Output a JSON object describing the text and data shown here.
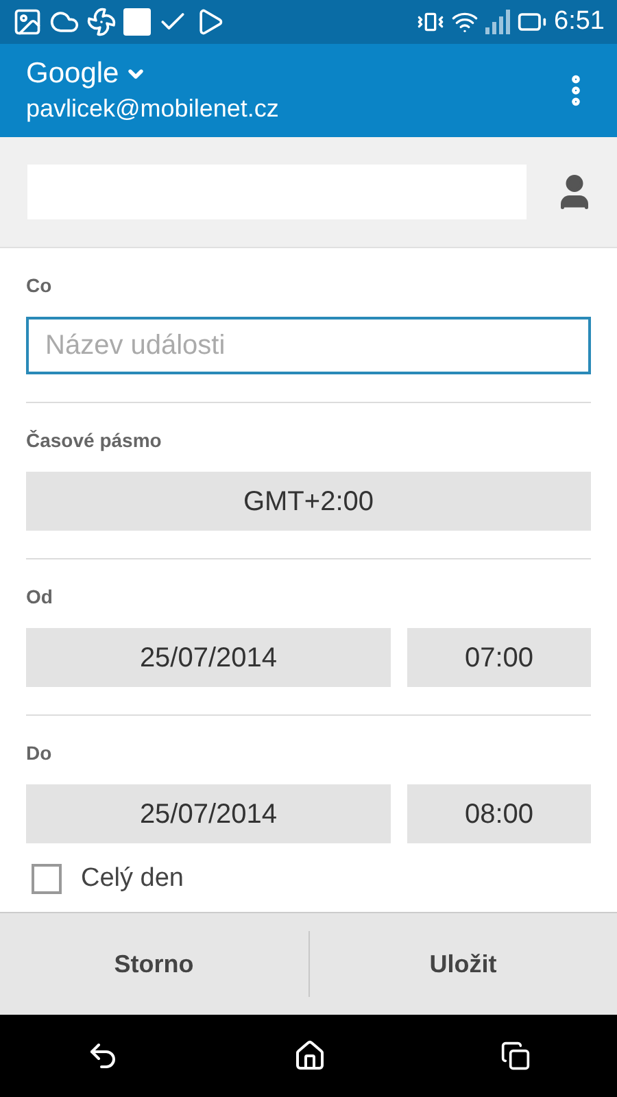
{
  "status_bar": {
    "time": "6:51"
  },
  "header": {
    "account": "Google",
    "email": "pavlicek@mobilenet.cz"
  },
  "what": {
    "label": "Co",
    "placeholder": "Název události",
    "focused": true
  },
  "timezone": {
    "label": "Časové pásmo",
    "value": "GMT+2:00"
  },
  "from": {
    "label": "Od",
    "date": "25/07/2014",
    "time": "07:00"
  },
  "to": {
    "label": "Do",
    "date": "25/07/2014",
    "time": "08:00"
  },
  "all_day": {
    "label": "Celý den",
    "checked": false
  },
  "buttons": [
    "Storno",
    "Uložit"
  ]
}
